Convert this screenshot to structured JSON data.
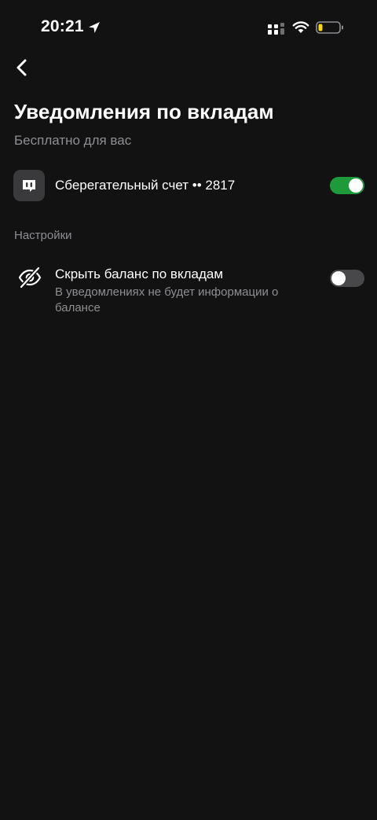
{
  "status_bar": {
    "time": "20:21",
    "icons": [
      "location-arrow-icon",
      "cellular-signal-icon",
      "wifi-icon",
      "battery-low-icon"
    ]
  },
  "header": {
    "back_icon": "chevron-left-icon",
    "title": "Уведомления по вкладам",
    "subtitle": "Бесплатно для вас"
  },
  "account": {
    "icon": "savings-account-icon",
    "label": "Сберегательный счет •• 2817",
    "enabled": true
  },
  "settings": {
    "section_title": "Настройки",
    "items": [
      {
        "icon": "eye-off-icon",
        "title": "Скрыть баланс по вкладам",
        "description": "В уведомлениях не будет информации о балансе",
        "enabled": false
      }
    ]
  },
  "colors": {
    "background": "#121212",
    "toggle_on": "#1f9a3a",
    "toggle_off": "#48484a",
    "secondary_text": "#8e8e93",
    "battery_level": "#f5d90a"
  }
}
